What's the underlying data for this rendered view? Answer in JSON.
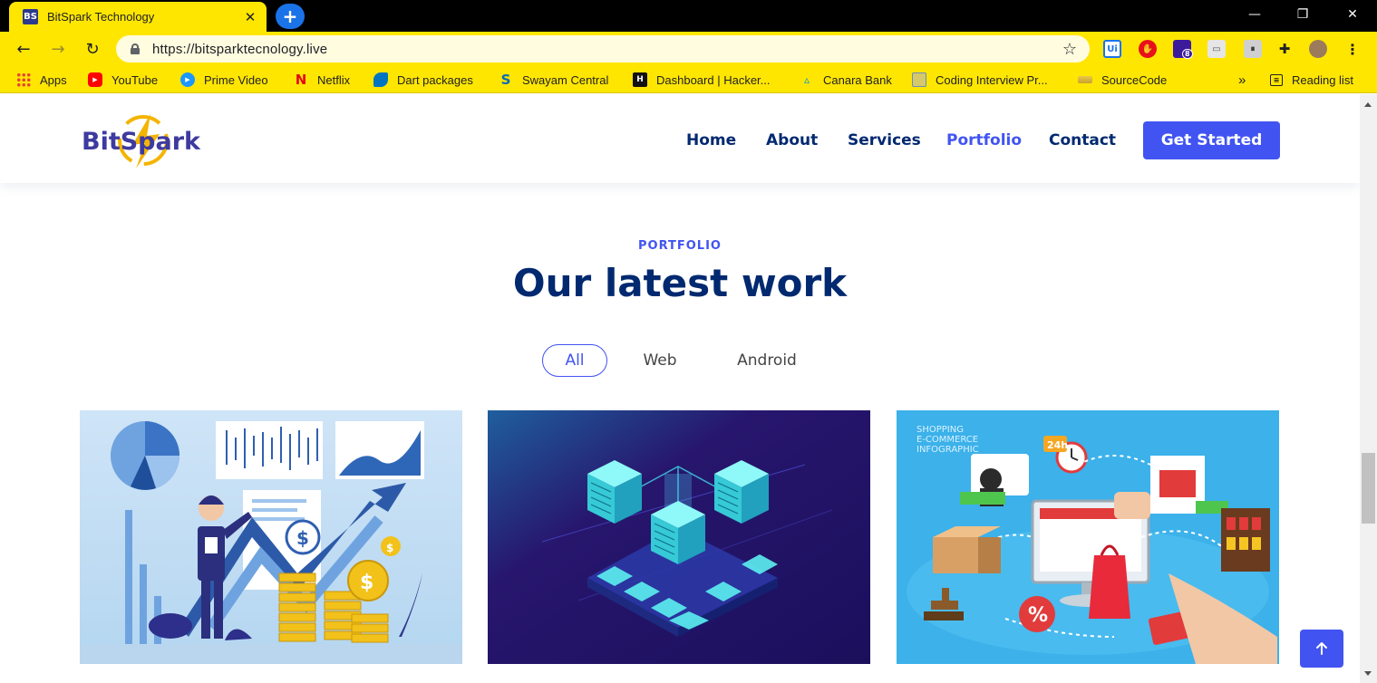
{
  "browser": {
    "tab_title": "BitSpark Technology",
    "tab_favicon_text": "BS",
    "url": "https://bitsparktecnology.live",
    "new_tab": "+",
    "bookmarks": [
      {
        "label": "Apps",
        "icon": "apps-grid-icon"
      },
      {
        "label": "YouTube",
        "icon": "youtube-icon"
      },
      {
        "label": "Prime Video",
        "icon": "prime-video-icon"
      },
      {
        "label": "Netflix",
        "icon": "netflix-icon"
      },
      {
        "label": "Dart packages",
        "icon": "dart-icon"
      },
      {
        "label": "Swayam Central",
        "icon": "swayam-icon"
      },
      {
        "label": "Dashboard | Hacker...",
        "icon": "hackerearth-icon"
      },
      {
        "label": "Canara Bank",
        "icon": "canara-bank-icon"
      },
      {
        "label": "Coding Interview Pr...",
        "icon": "folder-icon"
      },
      {
        "label": "SourceCode",
        "icon": "sourcecode-icon"
      }
    ],
    "bookmarks_overflow": "»",
    "reading_list": "Reading list",
    "extension_badge": "8"
  },
  "site": {
    "logo_text": "BitSpark",
    "nav": {
      "home": "Home",
      "about": "About",
      "services": "Services",
      "portfolio": "Portfolio",
      "contact": "Contact"
    },
    "cta": "Get Started"
  },
  "portfolio": {
    "subtitle": "PORTFOLIO",
    "title": "Our latest work",
    "filters": [
      "All",
      "Web",
      "Android"
    ],
    "active_filter": "All",
    "cards": [
      {
        "name": "business-growth-illustration"
      },
      {
        "name": "isometric-servers-illustration"
      },
      {
        "name": "ecommerce-infographic-illustration",
        "overlay_text": [
          "SHOPPING",
          "E-COMMERCE",
          "INFOGRAPHIC"
        ],
        "badge": "24h"
      }
    ]
  },
  "colors": {
    "accent": "#4154f1",
    "navy": "#012970",
    "chrome_yellow": "#ffe600"
  }
}
